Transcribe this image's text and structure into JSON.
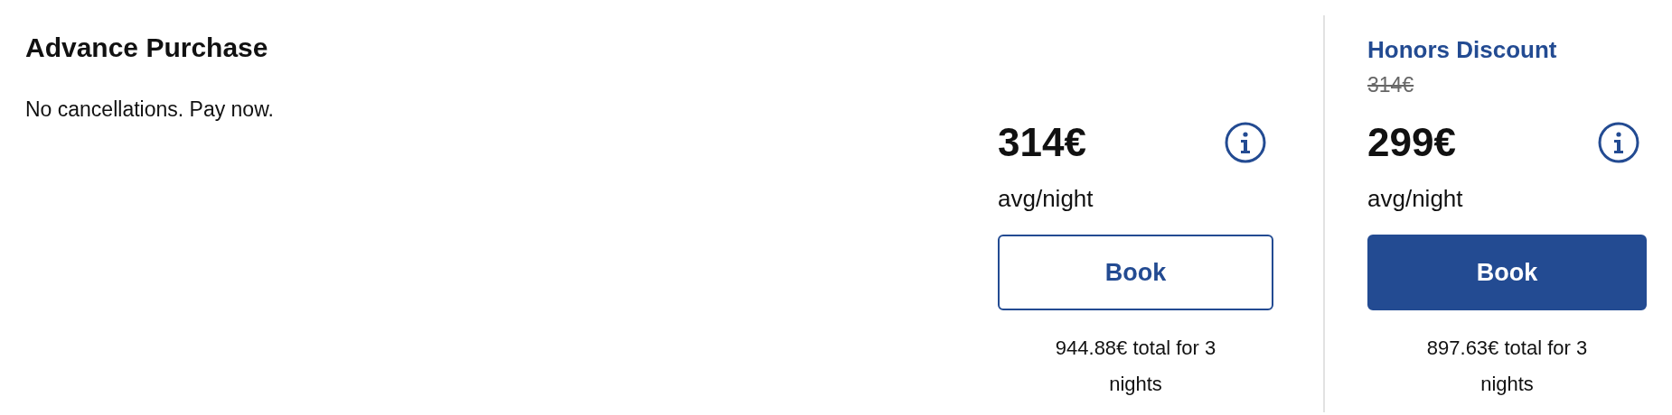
{
  "rate": {
    "title": "Advance Purchase",
    "description": "No cancellations. Pay now."
  },
  "offers": [
    {
      "kind": "standard",
      "price": "314€",
      "unit": "avg/night",
      "button": {
        "label": "Book"
      },
      "total": "944.88€ total for 3 nights"
    },
    {
      "kind": "member",
      "label": "Honors Discount",
      "original_price": "314€",
      "price": "299€",
      "unit": "avg/night",
      "button": {
        "label": "Book"
      },
      "total": "897.63€ total for 3 nights"
    }
  ]
}
